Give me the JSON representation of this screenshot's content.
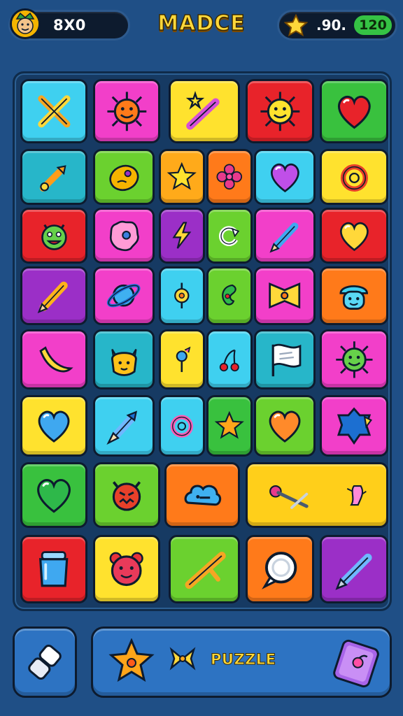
{
  "header": {
    "player_score": "8X0",
    "title": "MADCE",
    "stars_value": ".90.",
    "level": "120"
  },
  "icons": {
    "avatar": "player-avatar",
    "star": "star-icon"
  },
  "board": {
    "tiles": [
      {
        "name": "tile-crossed-sword",
        "color": "#3fd0f0",
        "icon": "crossed-sword-icon"
      },
      {
        "name": "tile-orange-sun-face",
        "color": "#f23fc9",
        "icon": "sun-face-icon"
      },
      {
        "name": "tile-star-wand",
        "color": "#ffe22e",
        "icon": "star-wand-icon"
      },
      {
        "name": "tile-yellow-sun-face",
        "color": "#e8232a",
        "icon": "sun-face-icon"
      },
      {
        "name": "tile-red-heart",
        "color": "#39c13e",
        "icon": "heart-icon"
      },
      {
        "name": "tile-rocket",
        "color": "#27b6c9",
        "icon": "rocket-icon"
      },
      {
        "name": "tile-egg",
        "color": "#6bd12f",
        "icon": "egg-icon"
      },
      {
        "name": "tile-small-star",
        "color": "#ffaa1a",
        "icon": "star-icon"
      },
      {
        "name": "tile-pink-flower",
        "color": "#ff7a1a",
        "icon": "flower-icon"
      },
      {
        "name": "tile-purple-heart",
        "color": "#3fd0f0",
        "icon": "heart-icon"
      },
      {
        "name": "tile-ring",
        "color": "#ffe22e",
        "icon": "ring-icon"
      },
      {
        "name": "tile-green-monster",
        "color": "#e8232a",
        "icon": "monster-icon"
      },
      {
        "name": "tile-cookie",
        "color": "#f23fc9",
        "icon": "cookie-icon"
      },
      {
        "name": "tile-lightning",
        "color": "#9b2fc7",
        "icon": "lightning-icon"
      },
      {
        "name": "tile-arrow-loop",
        "color": "#6bd12f",
        "icon": "arrow-loop-icon"
      },
      {
        "name": "tile-pencil-blue",
        "color": "#f23fc9",
        "icon": "pencil-icon"
      },
      {
        "name": "tile-yellow-heart",
        "color": "#e8232a",
        "icon": "heart-icon"
      },
      {
        "name": "tile-pencil-gold",
        "color": "#9b2fc7",
        "icon": "pencil-icon"
      },
      {
        "name": "tile-planet",
        "color": "#f23fc9",
        "icon": "planet-icon"
      },
      {
        "name": "tile-eye-target",
        "color": "#3fd0f0",
        "icon": "target-icon"
      },
      {
        "name": "tile-leaf",
        "color": "#6bd12f",
        "icon": "leaf-icon"
      },
      {
        "name": "tile-bow",
        "color": "#f23fc9",
        "icon": "bow-icon"
      },
      {
        "name": "tile-blue-face",
        "color": "#ff7a1a",
        "icon": "mushroom-face-icon"
      },
      {
        "name": "tile-banana",
        "color": "#f23fc9",
        "icon": "banana-icon"
      },
      {
        "name": "tile-cat-face",
        "color": "#27b6c9",
        "icon": "cat-face-icon"
      },
      {
        "name": "tile-candy",
        "color": "#ffe22e",
        "icon": "candy-icon"
      },
      {
        "name": "tile-cherries",
        "color": "#3fd0f0",
        "icon": "cherries-icon"
      },
      {
        "name": "tile-flag",
        "color": "#27b6c9",
        "icon": "flag-icon"
      },
      {
        "name": "tile-green-sun",
        "color": "#f23fc9",
        "icon": "sun-face-icon"
      },
      {
        "name": "tile-blue-heart",
        "color": "#ffe22e",
        "icon": "heart-icon"
      },
      {
        "name": "tile-crayon",
        "color": "#3fd0f0",
        "icon": "crayon-icon"
      },
      {
        "name": "tile-pink-ring",
        "color": "#3fd0f0",
        "icon": "ring-icon"
      },
      {
        "name": "tile-orange-star",
        "color": "#39c13e",
        "icon": "star-icon"
      },
      {
        "name": "tile-orange-heart",
        "color": "#6bd12f",
        "icon": "heart-icon"
      },
      {
        "name": "tile-blue-gem",
        "color": "#f23fc9",
        "icon": "gem-icon"
      },
      {
        "name": "tile-green-heart",
        "color": "#39c13e",
        "icon": "heart-icon"
      },
      {
        "name": "tile-devil-face",
        "color": "#6bd12f",
        "icon": "devil-face-icon"
      },
      {
        "name": "tile-cloud",
        "color": "#ff7a1a",
        "icon": "cloud-icon"
      },
      {
        "name": "tile-wide-tools",
        "color": "#ffcf1a",
        "icon": "tools-icon"
      },
      {
        "name": "tile-blue-jar",
        "color": "#e8232a",
        "icon": "jar-icon"
      },
      {
        "name": "tile-pink-bear",
        "color": "#ffe22e",
        "icon": "bear-face-icon"
      },
      {
        "name": "tile-stick",
        "color": "#6bd12f",
        "icon": "stick-icon"
      },
      {
        "name": "tile-bubble",
        "color": "#ff7a1a",
        "icon": "bubble-icon"
      },
      {
        "name": "tile-purple-pen",
        "color": "#9b2fc7",
        "icon": "pen-icon"
      }
    ]
  },
  "bottom": {
    "puzzle_label": "PUZZLE"
  }
}
